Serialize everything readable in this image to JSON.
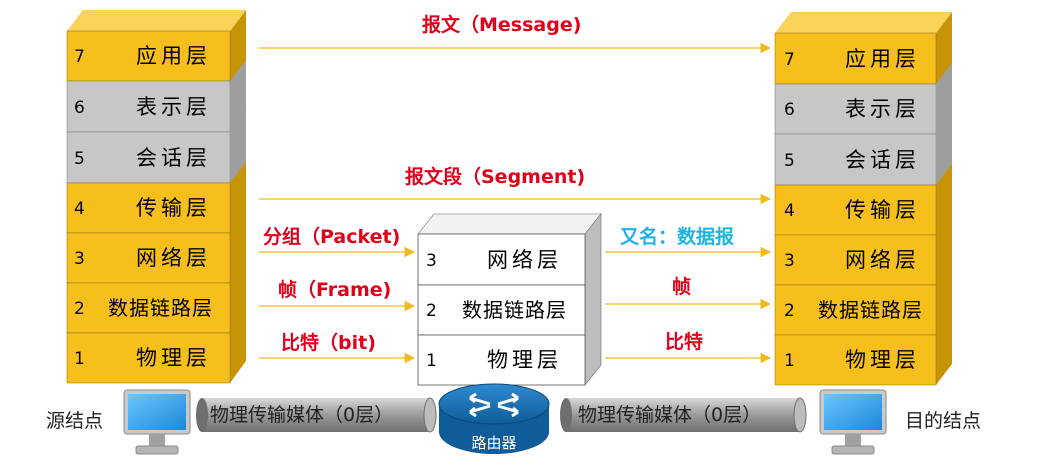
{
  "left_stack": {
    "layers": [
      {
        "num": "7",
        "name": "应用层"
      },
      {
        "num": "6",
        "name": "表示层"
      },
      {
        "num": "5",
        "name": "会话层"
      },
      {
        "num": "4",
        "name": "传输层"
      },
      {
        "num": "3",
        "name": "网络层"
      },
      {
        "num": "2",
        "name": "数据链路层"
      },
      {
        "num": "1",
        "name": "物理层"
      }
    ]
  },
  "right_stack": {
    "layers": [
      {
        "num": "7",
        "name": "应用层"
      },
      {
        "num": "6",
        "name": "表示层"
      },
      {
        "num": "5",
        "name": "会话层"
      },
      {
        "num": "4",
        "name": "传输层"
      },
      {
        "num": "3",
        "name": "网络层"
      },
      {
        "num": "2",
        "name": "数据链路层"
      },
      {
        "num": "1",
        "name": "物理层"
      }
    ]
  },
  "router_stack": {
    "layers": [
      {
        "num": "3",
        "name": "网络层"
      },
      {
        "num": "2",
        "name": "数据链路层"
      },
      {
        "num": "1",
        "name": "物理层"
      }
    ]
  },
  "pdu_labels": {
    "message": "报文（Message)",
    "segment": "报文段（Segment)",
    "packet": "分组（Packet)",
    "frame": "帧（Frame)",
    "bit": "比特（bit)",
    "datagram": "又名：数据报",
    "frame_right": "帧",
    "bit_right": "比特"
  },
  "nodes": {
    "source": "源结点",
    "destination": "目的结点",
    "router": "路由器",
    "medium_left": "物理传输媒体（0层）",
    "medium_right": "物理传输媒体（0层）"
  },
  "colors": {
    "gold": "#f6bf1c",
    "gold_top": "#f9d35a",
    "gold_side": "#c89407",
    "gray": "#c7c7c7",
    "gray_top": "#dedede",
    "gray_side": "#9e9e9e",
    "white": "#ffffff",
    "white_top": "#f2f2f2",
    "white_side": "#bdbdbd",
    "arrow": "#f3b81a",
    "red": "#e1001a",
    "cyan": "#1fb3e2",
    "router_blue": "#1a6fb3"
  }
}
